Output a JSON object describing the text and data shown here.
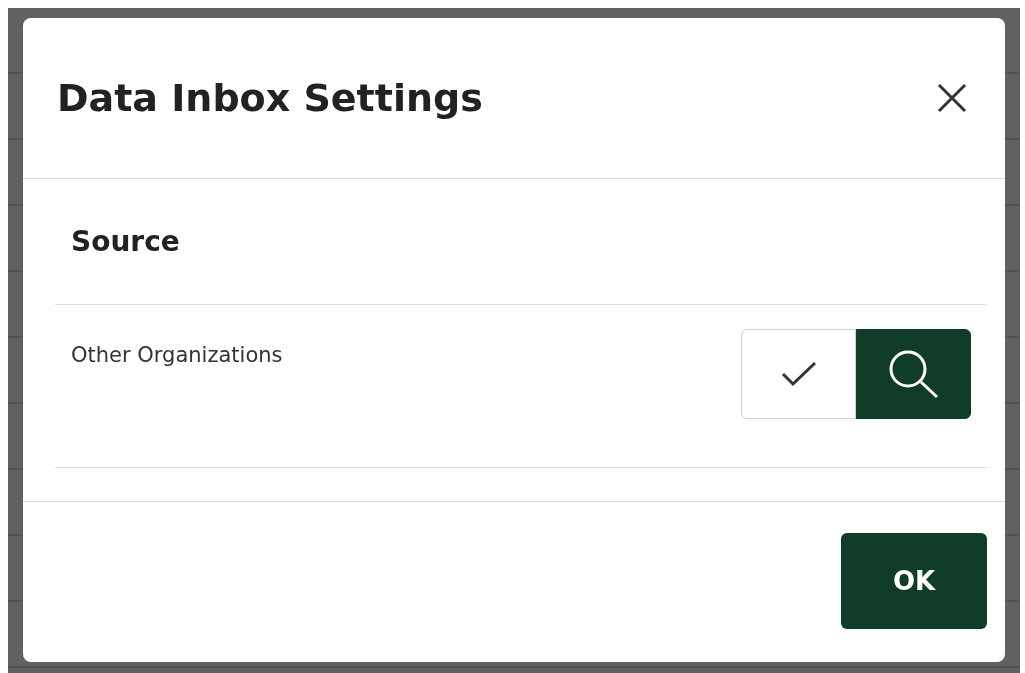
{
  "dialog": {
    "title": "Data Inbox Settings",
    "section": "Source",
    "rows": [
      {
        "label": "Other Organizations",
        "options": [
          {
            "kind": "check",
            "selected": false
          },
          {
            "kind": "search",
            "selected": true
          }
        ]
      }
    ],
    "buttons": [
      "OK"
    ]
  }
}
